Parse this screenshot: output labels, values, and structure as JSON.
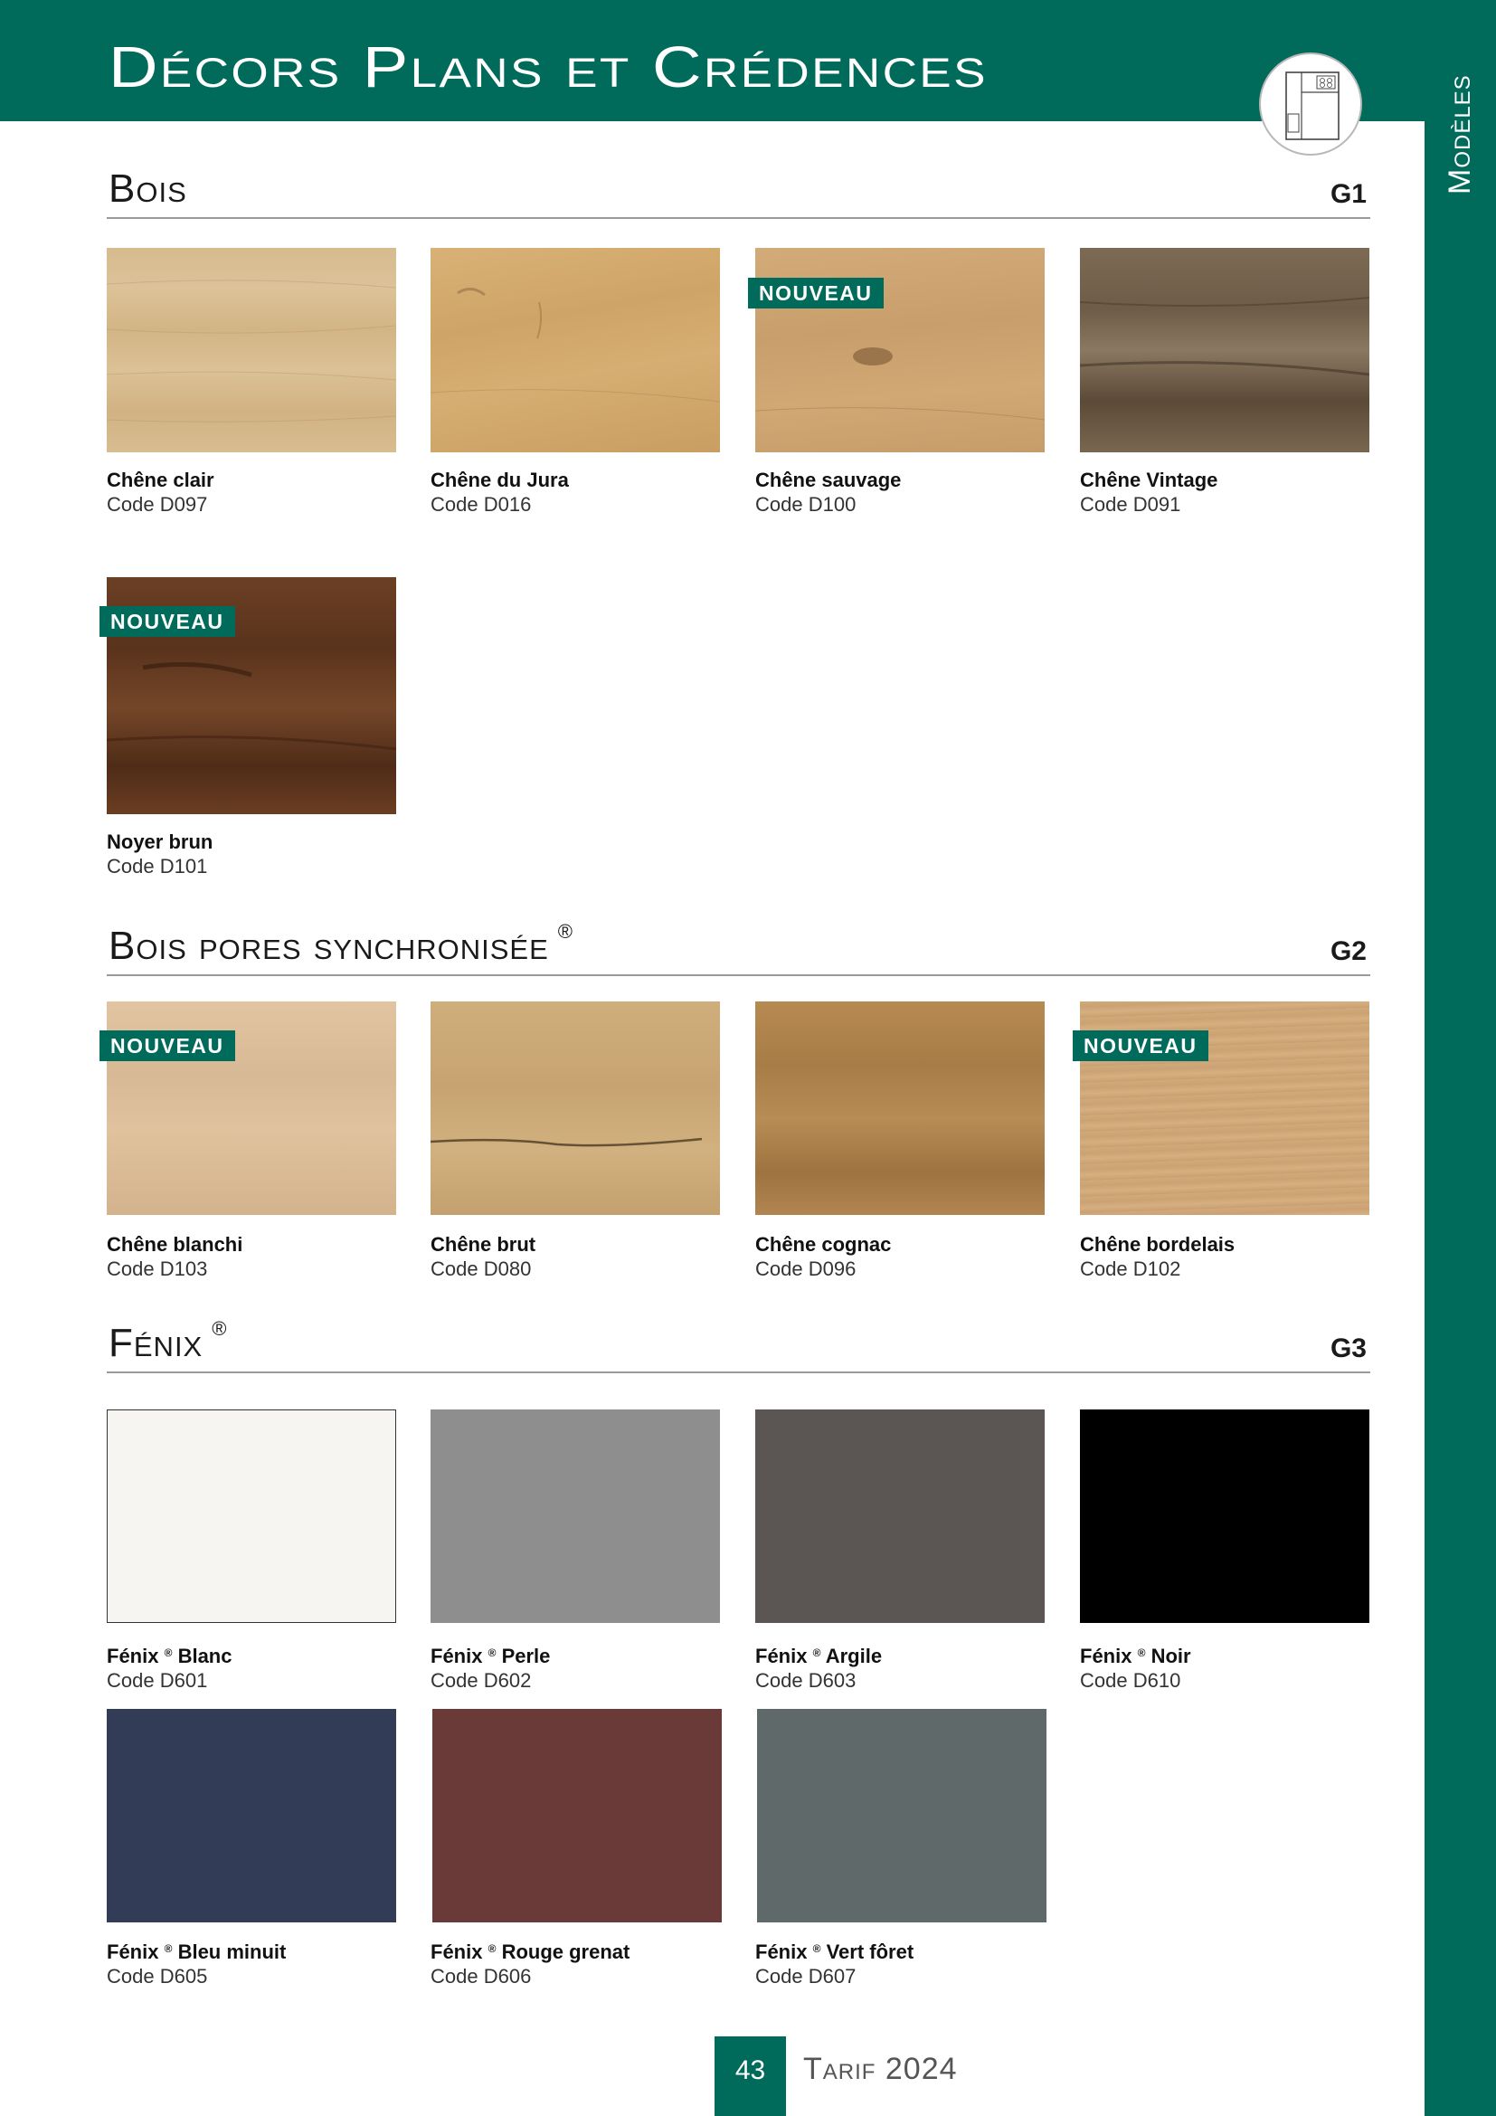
{
  "page": {
    "title": "Décors Plans et Crédences",
    "side_label": "Modèles",
    "page_number": "43",
    "footer": "Tarif 2024"
  },
  "badge_label": "NOUVEAU",
  "colors": {
    "brand": "#006a5b"
  },
  "sections": [
    {
      "title": "Bois",
      "group": "G1",
      "trademark": "",
      "items": [
        {
          "name": "Chêne clair",
          "code": "Code D097",
          "new": false
        },
        {
          "name": "Chêne du Jura",
          "code": "Code D016",
          "new": false
        },
        {
          "name": "Chêne sauvage",
          "code": "Code D100",
          "new": true
        },
        {
          "name": "Chêne Vintage",
          "code": "Code D091",
          "new": false
        },
        {
          "name": "Noyer brun",
          "code": "Code D101",
          "new": true
        }
      ]
    },
    {
      "title": "Bois pores synchronisée",
      "group": "G2",
      "trademark": "®",
      "items": [
        {
          "name": "Chêne blanchi",
          "code": "Code D103",
          "new": true
        },
        {
          "name": "Chêne brut",
          "code": "Code D080",
          "new": false
        },
        {
          "name": "Chêne cognac",
          "code": "Code D096",
          "new": false
        },
        {
          "name": "Chêne bordelais",
          "code": "Code D102",
          "new": true
        }
      ]
    },
    {
      "title": "Fénix",
      "group": "G3",
      "trademark": "®",
      "items": [
        {
          "brand": "Fénix",
          "mark": "®",
          "name": "Blanc",
          "code": "Code D601",
          "color": "#f6f5f1"
        },
        {
          "brand": "Fénix",
          "mark": "®",
          "name": "Perle",
          "code": "Code D602",
          "color": "#8d8e8d"
        },
        {
          "brand": "Fénix",
          "mark": "®",
          "name": "Argile",
          "code": "Code D603",
          "color": "#5b5653"
        },
        {
          "brand": "Fénix",
          "mark": "®",
          "name": "Noir",
          "code": "Code D610",
          "color": "#000000"
        },
        {
          "brand": "Fénix",
          "mark": "®",
          "name": "Bleu minuit",
          "code": "Code D605",
          "color": "#323c56"
        },
        {
          "brand": "Fénix",
          "mark": "®",
          "name": "Rouge grenat",
          "code": "Code D606",
          "color": "#6a3a39"
        },
        {
          "brand": "Fénix",
          "mark": "®",
          "name": "Vert fôret",
          "code": "Code D607",
          "color": "#5f6969"
        }
      ]
    }
  ]
}
